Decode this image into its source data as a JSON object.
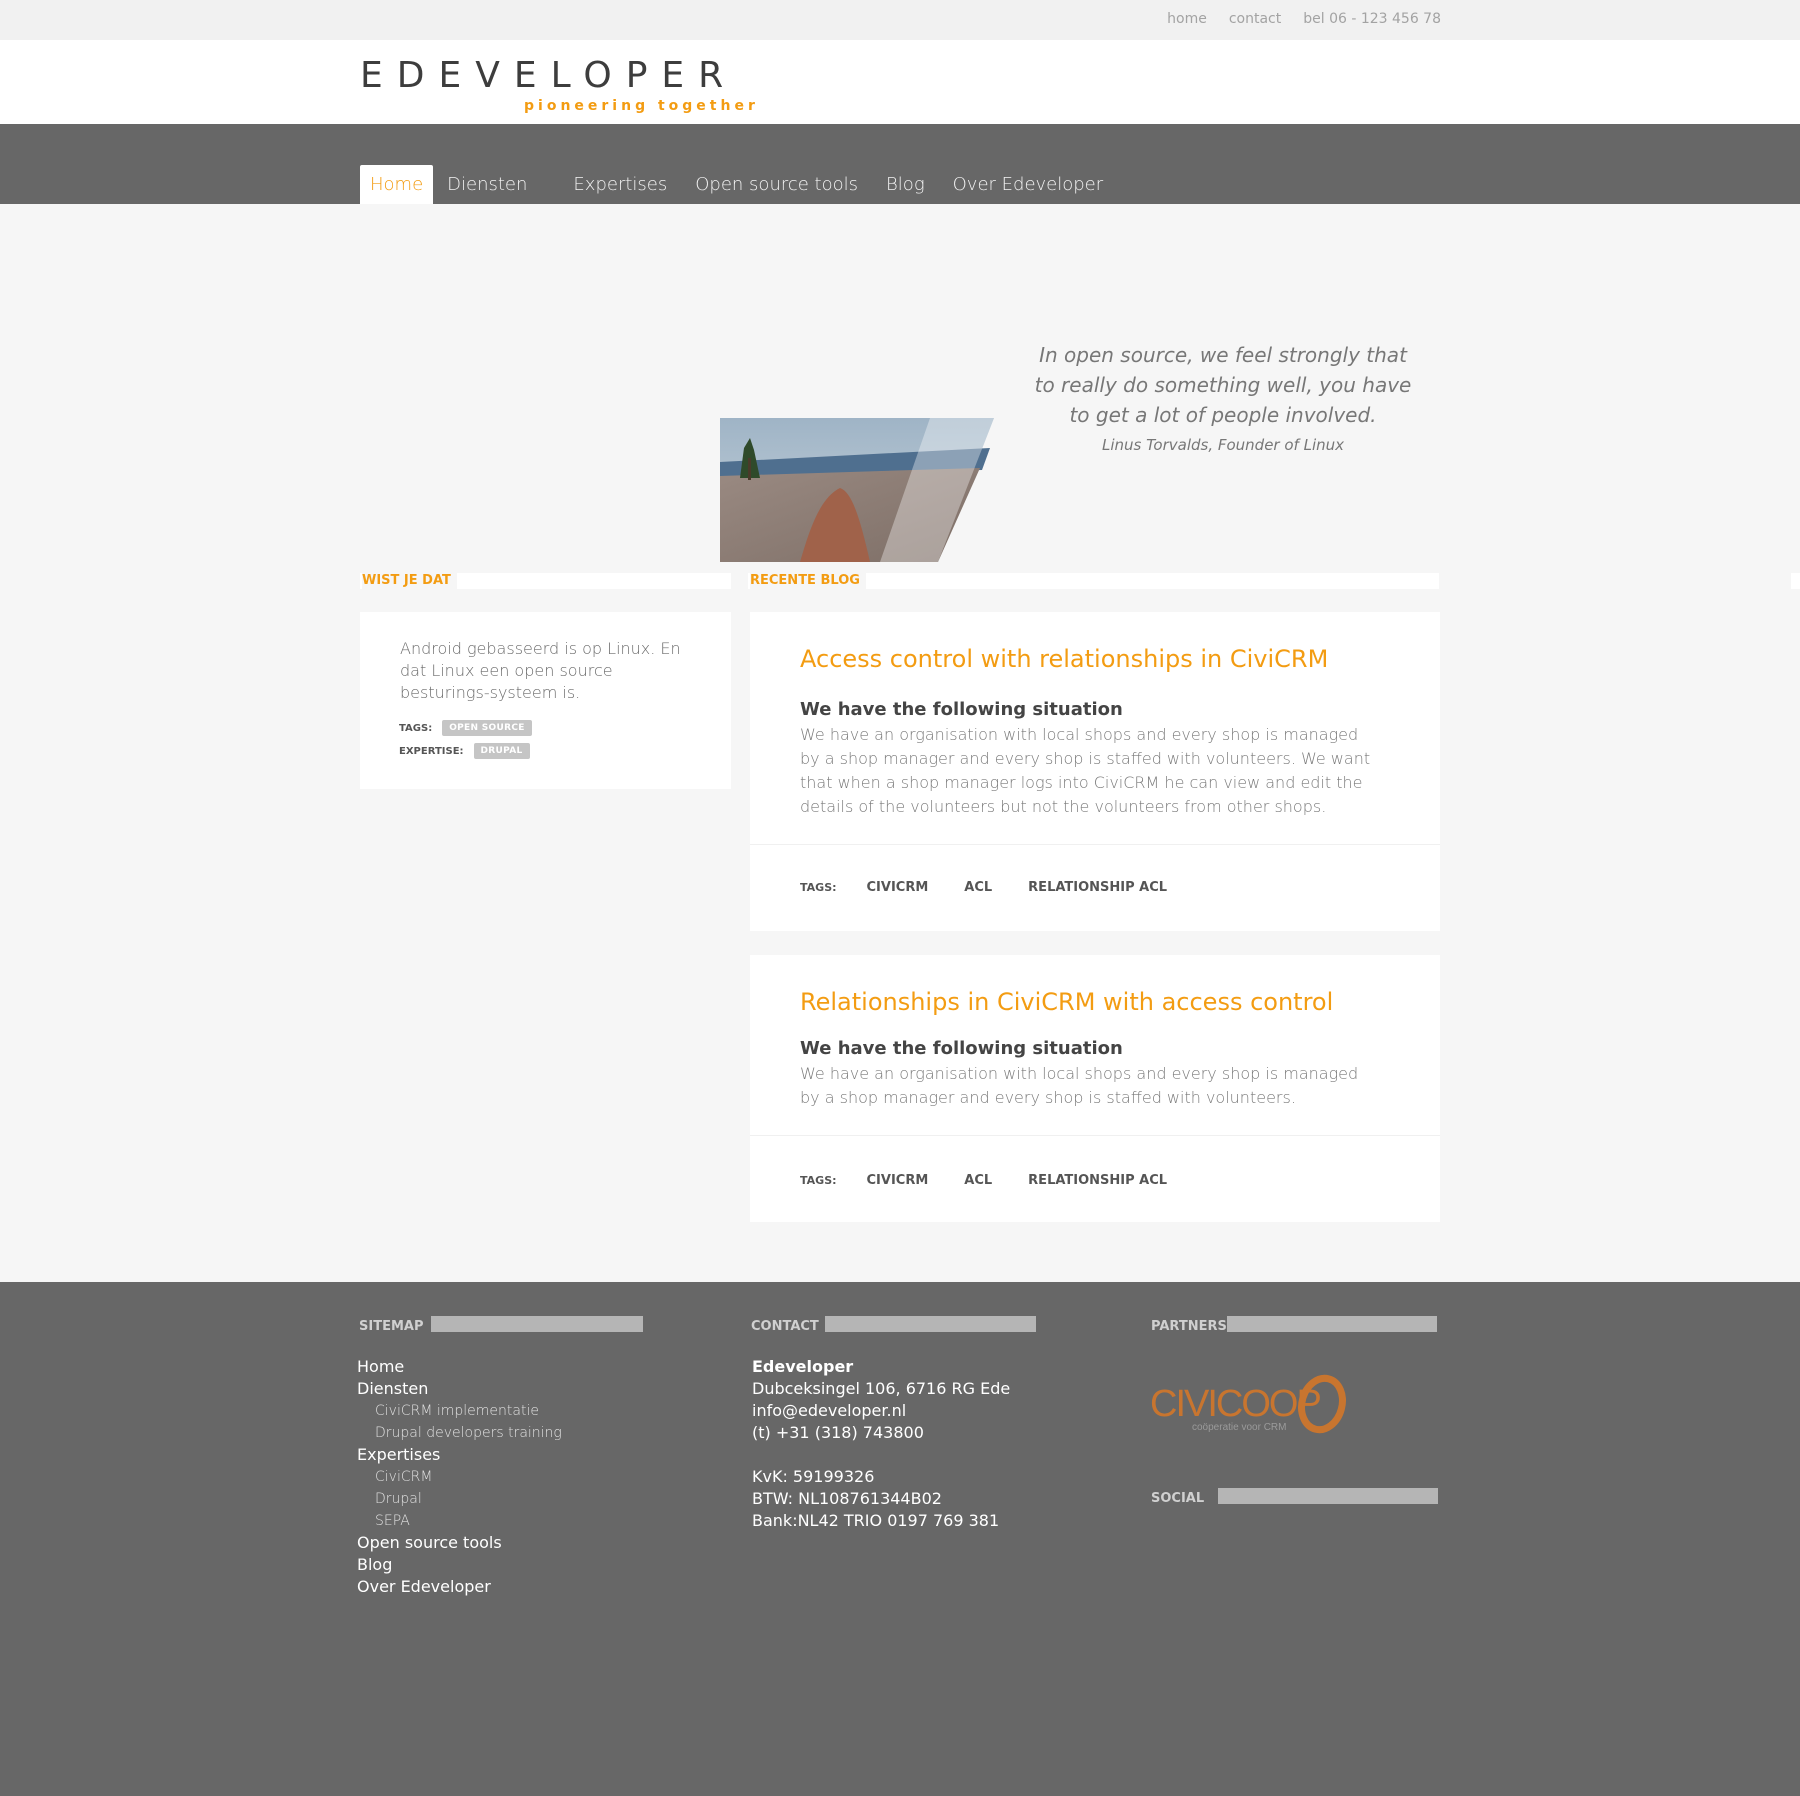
{
  "topbar": {
    "links": [
      "home",
      "contact",
      "bel 06 - 123 456 78"
    ]
  },
  "logo": {
    "word": "EDEVELOPER",
    "tagline": "pioneering together"
  },
  "nav": {
    "items": [
      "Home",
      "Diensten",
      "Expertises",
      "Open source tools",
      "Blog",
      "Over Edeveloper"
    ],
    "active": "Home"
  },
  "hero": {
    "quote": "In open source, we feel strongly that to really do something well, you have to get a lot of people involved.",
    "author": "Linus Torvalds, Founder of Linux"
  },
  "wist": {
    "heading": "WIST JE DAT",
    "text": "Android gebasseerd is op Linux. En dat Linux een open source besturings-systeem is.",
    "tags_label": "TAGS:",
    "tags": [
      "OPEN SOURCE"
    ],
    "expertise_label": "EXPERTISE:",
    "expertise": [
      "DRUPAL"
    ]
  },
  "blog": {
    "heading": "RECENTE BLOG",
    "posts": [
      {
        "title": "Access control with relationships in CiviCRM",
        "subtitle": "We have the following situation",
        "text": "We have an organisation with local shops and every shop is managed by a shop manager and every shop is staffed with volunteers. We want that when a shop manager logs into CiviCRM he can view and edit the details of the volunteers but not the volunteers from other shops.",
        "tags_label": "TAGS:",
        "tags": [
          "CIVICRM",
          "ACL",
          "RELATIONSHIP ACL"
        ]
      },
      {
        "title": "Relationships in CiviCRM with access control",
        "subtitle": "We have the following situation",
        "text": "We have an organisation with local shops and every shop is managed by a shop manager and every shop is staffed with volunteers.",
        "tags_label": "TAGS:",
        "tags": [
          "CIVICRM",
          "ACL",
          "RELATIONSHIP ACL"
        ]
      }
    ]
  },
  "footer": {
    "sitemap": {
      "heading": "SITEMAP",
      "items": [
        "Home",
        "Diensten",
        "CiviCRM implementatie",
        "Drupal developers training",
        "Expertises",
        "CiviCRM",
        "Drupal",
        "SEPA",
        "Open source tools",
        "Blog",
        "Over Edeveloper"
      ]
    },
    "contact": {
      "heading": "CONTACT",
      "name": "Edeveloper",
      "address": "Dubceksingel 106, 6716 RG Ede",
      "email": "info@edeveloper.nl",
      "phone": "(t) +31 (318) 743800",
      "kvk": "KvK: 59199326",
      "btw": "BTW: NL108761344B02",
      "bank": "Bank:NL42 TRIO 0197 769 381"
    },
    "partners": {
      "heading": "PARTNERS",
      "logo_word": "CIVICOOP",
      "logo_sub": "coöperatie voor CRM"
    },
    "social": {
      "heading": "SOCIAL"
    }
  },
  "colors": {
    "accent": "#f39c12",
    "nav_bg": "#676767",
    "page_bg": "#f6f6f6"
  }
}
